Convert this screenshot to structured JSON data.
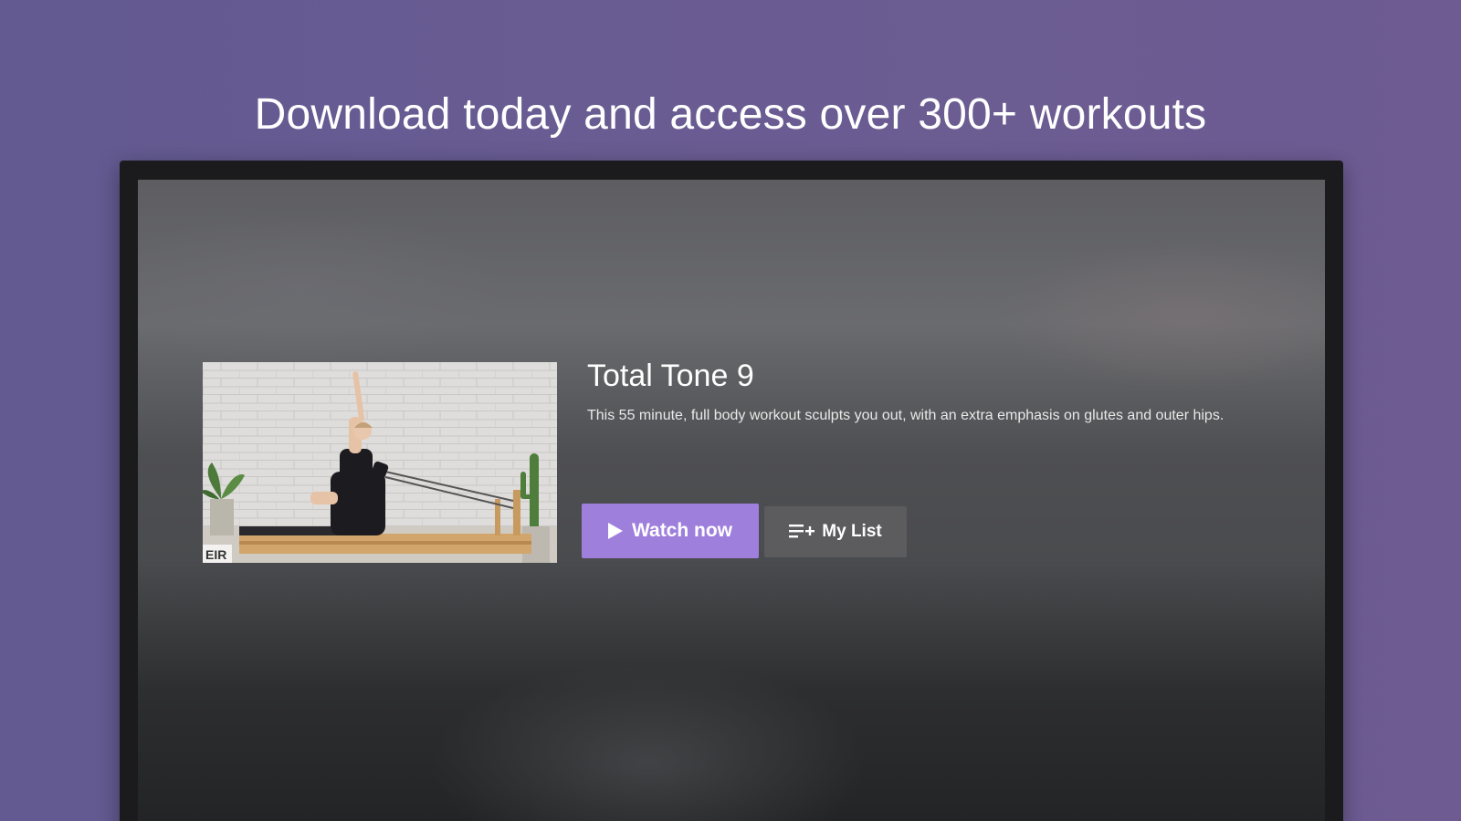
{
  "promo": {
    "headline": "Download today and access over 300+ workouts"
  },
  "hero": {
    "title": "Total Tone 9",
    "description": "This 55 minute, full body workout sculpts you out, with an extra emphasis on glutes and outer hips.",
    "thumbnail_icon": "workout-video-thumbnail",
    "watermark_text": "EIR"
  },
  "actions": {
    "watch_now_label": "Watch now",
    "watch_now_icon": "play-icon",
    "my_list_label": "My List",
    "my_list_icon": "playlist-add-icon"
  },
  "colors": {
    "background": "#675b92",
    "accent": "#9f7fdc",
    "secondary_button": "#5f5f62",
    "tv_frame": "#1b1b1d"
  }
}
